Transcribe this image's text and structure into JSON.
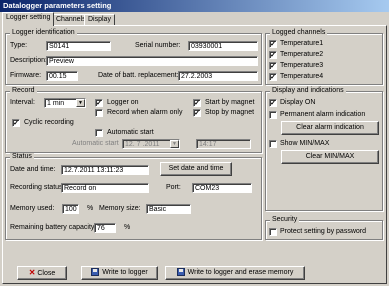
{
  "window": {
    "title": "Datalogger parameters setting"
  },
  "tabs": [
    "Logger setting",
    "Channels",
    "Display"
  ],
  "identification": {
    "title": "Logger identification",
    "type_label": "Type:",
    "type_value": "S0141",
    "serial_label": "Serial number:",
    "serial_value": "03930001",
    "desc_label": "Description:",
    "desc_value": "Preview",
    "fw_label": "Firmware:",
    "fw_value": "00.15",
    "batt_label": "Date of batt. replacement:",
    "batt_value": "27.2.2003"
  },
  "record": {
    "title": "Record",
    "interval_label": "Interval:",
    "interval_value": "1 min",
    "logger_on": "Logger on",
    "alarm_only": "Record when alarm only",
    "start_magnet": "Start by magnet",
    "stop_magnet": "Stop by magnet",
    "cyclic": "Cyclic recording",
    "auto_start": "Automatic start",
    "auto_start_label": "Automatic start",
    "auto_date": "12. 7 .2011",
    "auto_time": "14:17"
  },
  "status": {
    "title": "Status",
    "datetime_label": "Date and time:",
    "datetime_value": "12.7.2011 13:11:23",
    "set_datetime": "Set date and time",
    "rec_status_label": "Recording status:",
    "rec_status_value": "Record on",
    "port_label": "Port:",
    "port_value": "COM23",
    "mem_used_label": "Memory used:",
    "mem_used_value": "100",
    "mem_used_unit": "%",
    "mem_size_label": "Memory size:",
    "mem_size_value": "Basic",
    "battery_label": "Remaining battery capacity",
    "battery_value": "76",
    "battery_unit": "%"
  },
  "channels": {
    "title": "Logged channels",
    "items": [
      "Temperature1",
      "Temperature2",
      "Temperature3",
      "Temperature4"
    ]
  },
  "display": {
    "title": "Display and indications",
    "display_on": "Display ON",
    "perm_alarm": "Permanent alarm indication",
    "clear_alarm": "Clear alarm indication",
    "show_minmax": "Show MIN/MAX",
    "clear_minmax": "Clear MIN/MAX"
  },
  "security": {
    "title": "Security",
    "protect": "Protect setting by password"
  },
  "footer": {
    "close": "Close",
    "write": "Write to logger",
    "write_erase": "Write to logger and erase memory"
  },
  "check_mark": "✓",
  "dropdown_arrow": "▼",
  "icons": {
    "close": "close-icon",
    "write": "floppy-disk-icon"
  }
}
